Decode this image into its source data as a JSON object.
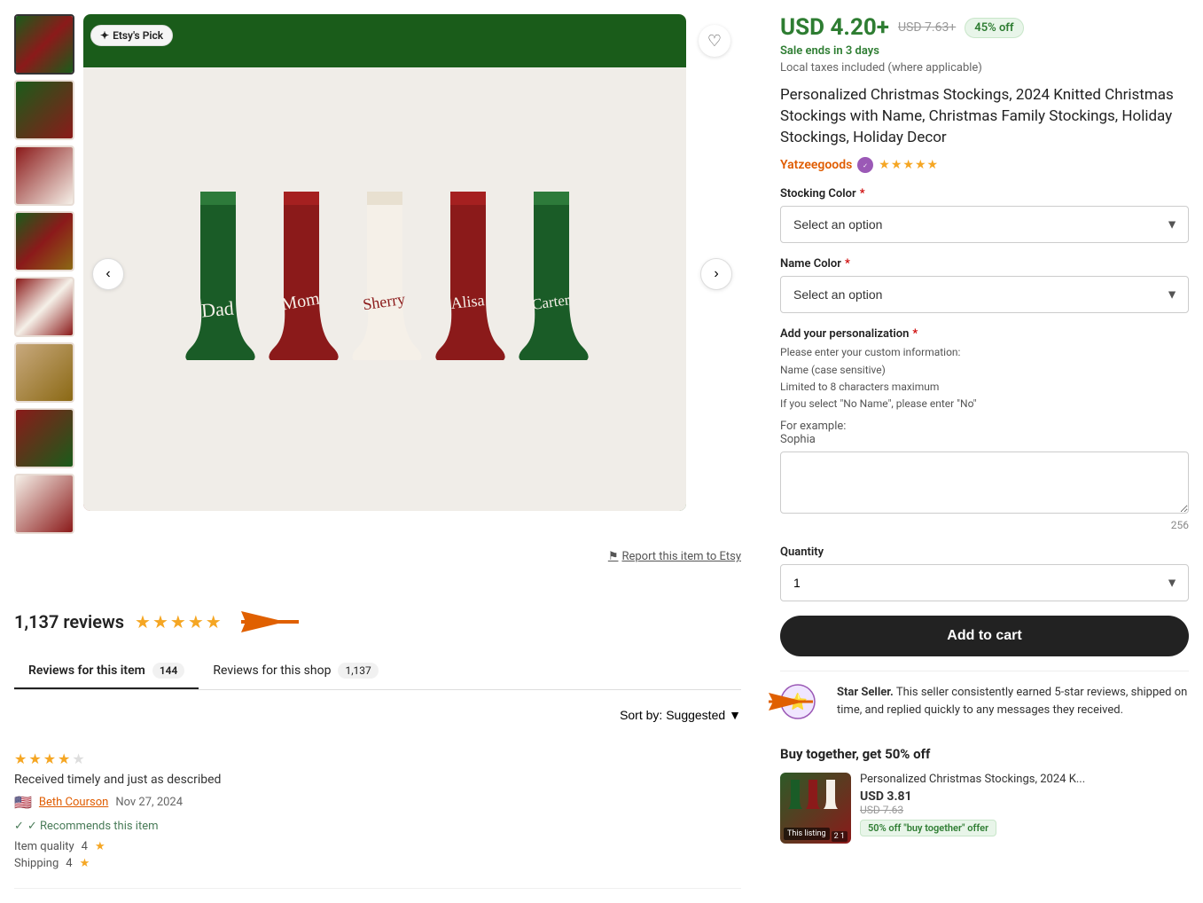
{
  "product": {
    "price_current": "USD 4.20+",
    "price_original": "USD 7.63+",
    "discount": "45% off",
    "sale_text": "Sale ends in 3 days",
    "tax_text": "Local taxes included (where applicable)",
    "title": "Personalized Christmas Stockings, 2024 Knitted Christmas Stockings with Name, Christmas Family Stockings, Holiday Stockings, Holiday Decor",
    "shop_name": "Yatzeegoods",
    "stocking_color_label": "Stocking Color",
    "name_color_label": "Name Color",
    "stocking_color_placeholder": "Select an option",
    "name_color_placeholder": "Select an option",
    "personalization_label": "Add your personalization",
    "personalization_hint": "Please enter your custom information:\nName (case sensitive)\nLimited to 8 characters maximum\nIf you select \"No Name\", please enter \"No\"",
    "example_label": "For example:",
    "example_value": "Sophia",
    "quantity_label": "Quantity",
    "quantity_value": "1",
    "char_count": "256",
    "add_to_cart_label": "Add to cart",
    "star_seller_text": "Star Seller. This seller consistently earned 5-star reviews, shipped on time, and replied quickly to any messages they received.",
    "buy_together_title": "Buy together, get 50% off",
    "buy_together_product": "Personalized Christmas Stockings, 2024 K...",
    "buy_together_price": "USD 3.81",
    "buy_together_orig": "USD 7.63",
    "buy_together_badge": "50% off \"buy together\" offer",
    "listing_label": "This listing",
    "report_text": "Report this item to Etsy"
  },
  "reviews": {
    "count": "1,137 reviews",
    "tab_item_label": "Reviews for this item",
    "tab_item_count": "144",
    "tab_shop_label": "Reviews for this shop",
    "tab_shop_count": "1,137",
    "sort_label": "Sort by: Suggested",
    "first_review": {
      "stars": 4,
      "text": "Received timely and just as described",
      "reviewer": "Beth Courson",
      "date": "Nov 27, 2024",
      "recommends": "✓ Recommends this item",
      "item_quality_label": "Item quality",
      "item_quality_value": "4",
      "shipping_label": "Shipping",
      "shipping_value": "4"
    }
  },
  "etsy_pick": "Etsy's Pick",
  "icons": {
    "heart": "♡",
    "prev": "‹",
    "next": "›",
    "flag": "⚑",
    "star_full": "★",
    "star_empty": "☆",
    "check": "✓",
    "dropdown": "▼",
    "star_badge": "⭐",
    "shop_badge": "●"
  }
}
